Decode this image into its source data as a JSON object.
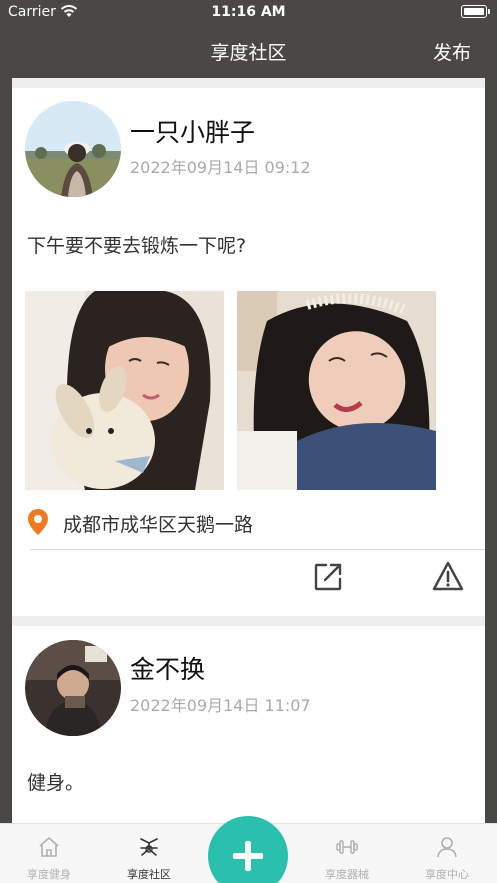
{
  "status_bar": {
    "carrier": "Carrier",
    "time": "11:16 AM"
  },
  "nav": {
    "title": "享度社区",
    "publish_label": "发布"
  },
  "posts": [
    {
      "username": "一只小胖子",
      "date": "2022年09月14日 09:12",
      "content": "下午要不要去锻炼一下呢?",
      "location": "成都市成华区天鹅一路"
    },
    {
      "username": "金不换",
      "date": "2022年09月14日 11:07",
      "content": "健身。"
    }
  ],
  "tabbar": {
    "items": [
      {
        "label": "享度健身",
        "icon": "home-icon",
        "active": false
      },
      {
        "label": "享度社区",
        "icon": "community-icon",
        "active": true
      },
      {
        "label": "享度器械",
        "icon": "dumbbell-icon",
        "active": false
      },
      {
        "label": "享度中心",
        "icon": "user-icon",
        "active": false
      }
    ]
  },
  "colors": {
    "accent": "#2bbfae",
    "nav_bg": "#4a4845",
    "location_pin": "#f07a22"
  }
}
